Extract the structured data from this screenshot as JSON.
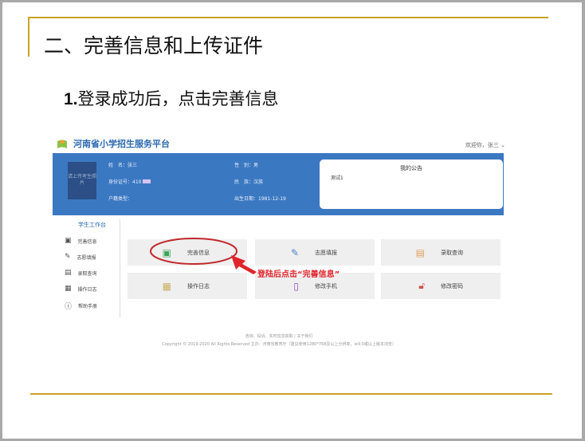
{
  "slide": {
    "title": "二、完善信息和上传证件",
    "step_number": "1.",
    "step_text": "登录成功后，点击完善信息"
  },
  "app": {
    "name": "河南省小学招生服务平台",
    "welcome": "欢迎你，张三",
    "photo_placeholder": "请上传考生照片",
    "student": {
      "name": "姓　名：张三",
      "id": "身份证号：410",
      "household": "户籍类型：",
      "gender": "性　别：男",
      "ethnicity": "民　族：汉族",
      "birth": "出生日期：1981-12-19"
    },
    "notice": {
      "title": "我的公告",
      "content": "测试1"
    },
    "sidebar": {
      "heading": "学生工作台",
      "items": [
        {
          "label": "完善信息",
          "icon": "id-card-icon"
        },
        {
          "label": "志愿填报",
          "icon": "form-edit-icon"
        },
        {
          "label": "录取查询",
          "icon": "search-doc-icon"
        },
        {
          "label": "操作日志",
          "icon": "calendar-log-icon"
        },
        {
          "label": "帮助手册",
          "icon": "info-icon"
        }
      ]
    },
    "tiles": [
      {
        "label": "完善信息",
        "icon": "id-card-icon",
        "color": "#3aa657"
      },
      {
        "label": "志愿填报",
        "icon": "form-edit-icon",
        "color": "#4a7fc8"
      },
      {
        "label": "录取查询",
        "icon": "search-doc-icon",
        "color": "#e0a060"
      },
      {
        "label": "操作日志",
        "icon": "calendar-log-icon",
        "color": "#c8b060"
      },
      {
        "label": "修改手机",
        "icon": "phone-icon",
        "color": "#8a4fc0"
      },
      {
        "label": "修改密码",
        "icon": "lock-icon",
        "color": "#d05050"
      }
    ],
    "footer": {
      "line1": "咨询、投诉、实时信息获取 | 关于我们",
      "line2": "Copyright © 2019-2020 All Rights Reserved 主办：河南省教育厅（建议使用1280*768及以上分辨率，ie9.0或以上版本浏览）"
    }
  },
  "annotation": "登陆后点击“完善信息”"
}
